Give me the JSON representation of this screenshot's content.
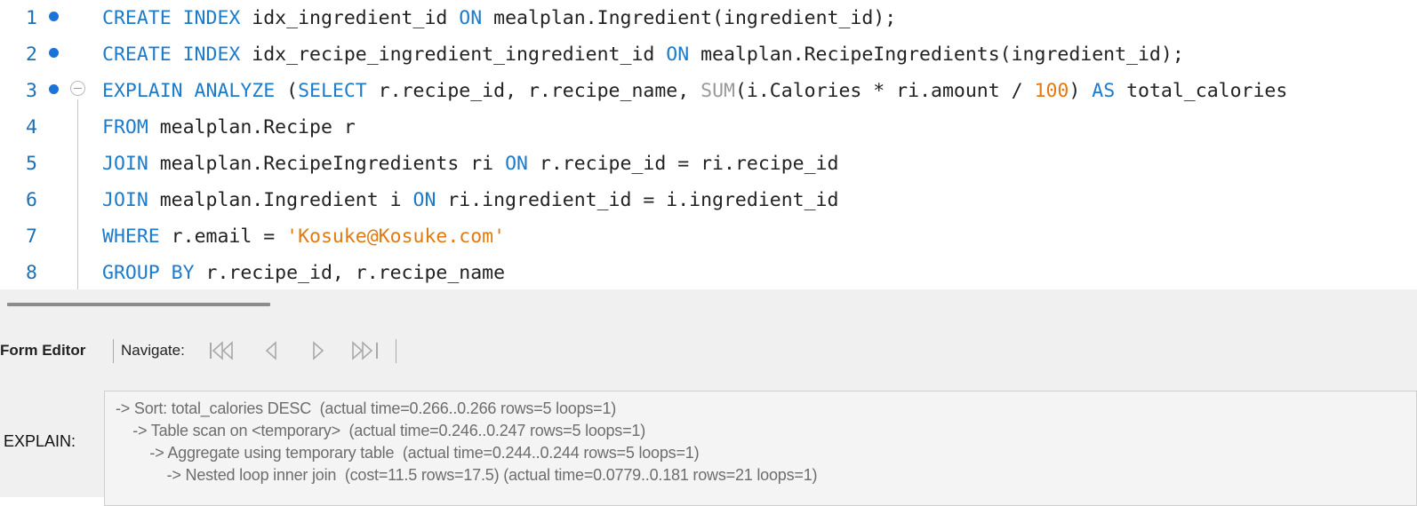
{
  "editor": {
    "lines": [
      {
        "number": "1",
        "has_marker": true,
        "has_fold": false,
        "tokens": [
          {
            "t": "CREATE INDEX",
            "c": "kw"
          },
          {
            "t": " idx_ingredient_id ",
            "c": "id"
          },
          {
            "t": "ON",
            "c": "kw"
          },
          {
            "t": " mealplan.Ingredient(ingredient_id);",
            "c": "id"
          }
        ]
      },
      {
        "number": "2",
        "has_marker": true,
        "has_fold": false,
        "tokens": [
          {
            "t": "CREATE INDEX",
            "c": "kw"
          },
          {
            "t": " idx_recipe_ingredient_ingredient_id ",
            "c": "id"
          },
          {
            "t": "ON",
            "c": "kw"
          },
          {
            "t": " mealplan.RecipeIngredients(ingredient_id);",
            "c": "id"
          }
        ]
      },
      {
        "number": "3",
        "has_marker": true,
        "has_fold": true,
        "tokens": [
          {
            "t": "EXPLAIN ANALYZE",
            "c": "kw"
          },
          {
            "t": " (",
            "c": "id"
          },
          {
            "t": "SELECT",
            "c": "kw"
          },
          {
            "t": " r.recipe_id, r.recipe_name, ",
            "c": "id"
          },
          {
            "t": "SUM",
            "c": "fn"
          },
          {
            "t": "(i.Calories * ri.amount / ",
            "c": "id"
          },
          {
            "t": "100",
            "c": "num"
          },
          {
            "t": ") ",
            "c": "id"
          },
          {
            "t": "AS",
            "c": "kw"
          },
          {
            "t": " total_calories",
            "c": "id"
          }
        ]
      },
      {
        "number": "4",
        "has_marker": false,
        "has_fold": false,
        "tokens": [
          {
            "t": "FROM",
            "c": "kw"
          },
          {
            "t": " mealplan.Recipe r",
            "c": "id"
          }
        ]
      },
      {
        "number": "5",
        "has_marker": false,
        "has_fold": false,
        "tokens": [
          {
            "t": "JOIN",
            "c": "kw"
          },
          {
            "t": " mealplan.RecipeIngredients ri ",
            "c": "id"
          },
          {
            "t": "ON",
            "c": "kw"
          },
          {
            "t": " r.recipe_id = ri.recipe_id",
            "c": "id"
          }
        ]
      },
      {
        "number": "6",
        "has_marker": false,
        "has_fold": false,
        "tokens": [
          {
            "t": "JOIN",
            "c": "kw"
          },
          {
            "t": " mealplan.Ingredient i ",
            "c": "id"
          },
          {
            "t": "ON",
            "c": "kw"
          },
          {
            "t": " ri.ingredient_id = i.ingredient_id",
            "c": "id"
          }
        ]
      },
      {
        "number": "7",
        "has_marker": false,
        "has_fold": false,
        "tokens": [
          {
            "t": "WHERE",
            "c": "kw"
          },
          {
            "t": " r.email = ",
            "c": "id"
          },
          {
            "t": "'Kosuke@Kosuke.com'",
            "c": "str"
          }
        ]
      },
      {
        "number": "8",
        "has_marker": false,
        "has_fold": false,
        "tokens": [
          {
            "t": "GROUP BY",
            "c": "kw"
          },
          {
            "t": " r.recipe_id, r.recipe_name",
            "c": "id"
          }
        ]
      }
    ]
  },
  "toolbar": {
    "form_editor_label": "Form Editor",
    "navigate_label": "Navigate:",
    "nav_buttons": [
      "first-record",
      "previous-record",
      "next-record",
      "last-record"
    ]
  },
  "explain": {
    "label": "EXPLAIN:",
    "lines": [
      "-> Sort: total_calories DESC  (actual time=0.266..0.266 rows=5 loops=1)",
      "    -> Table scan on <temporary>  (actual time=0.246..0.247 rows=5 loops=1)",
      "        -> Aggregate using temporary table  (actual time=0.244..0.244 rows=5 loops=1)",
      "            -> Nested loop inner join  (cost=11.5 rows=17.5) (actual time=0.0779..0.181 rows=21 loops=1)"
    ]
  },
  "colors": {
    "keyword": "#1c7bcb",
    "identifier": "#222222",
    "function": "#9a9a9a",
    "number": "#e07a12",
    "string": "#e07a12",
    "line_number": "#1f6fb2",
    "marker": "#1a73d9"
  }
}
